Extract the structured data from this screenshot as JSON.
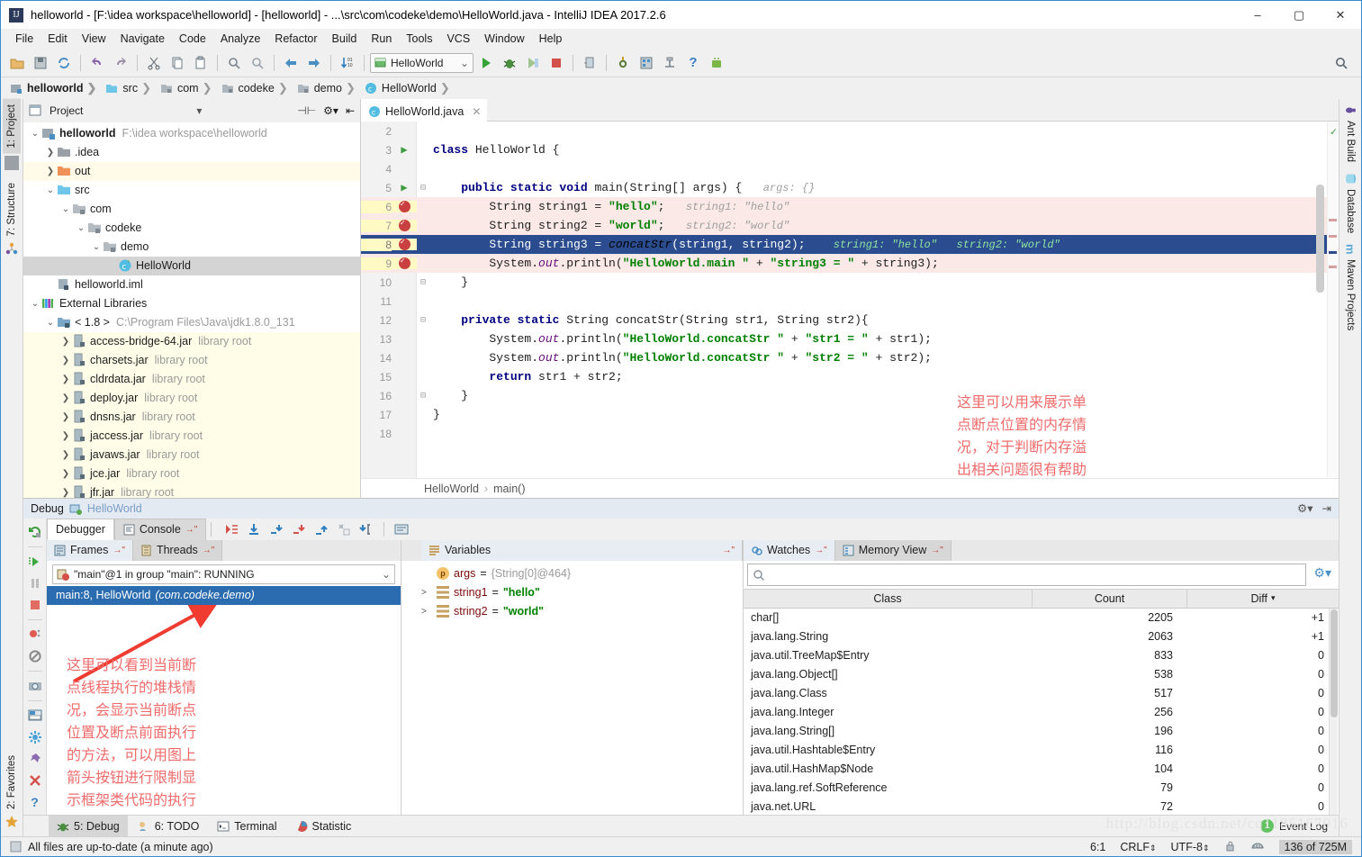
{
  "window": {
    "title": "helloworld - [F:\\idea workspace\\helloworld] - [helloworld] - ...\\src\\com\\codeke\\demo\\HelloWorld.java - IntelliJ IDEA 2017.2.6",
    "minimize": "–",
    "maximize": "▢",
    "close": "✕"
  },
  "menu": [
    "File",
    "Edit",
    "View",
    "Navigate",
    "Code",
    "Analyze",
    "Refactor",
    "Build",
    "Run",
    "Tools",
    "VCS",
    "Window",
    "Help"
  ],
  "toolbar": {
    "run_config": "HelloWorld",
    "icons": [
      "open-icon",
      "save-icon",
      "sync-icon",
      "undo-icon",
      "redo-icon",
      "cut-icon",
      "copy-icon",
      "paste-icon",
      "find-icon",
      "replace-icon",
      "back-icon",
      "forward-icon",
      "sort-icon"
    ],
    "right_icon": "search-everywhere-icon"
  },
  "breadcrumbs": [
    {
      "label": "helloworld",
      "icon": "module-icon"
    },
    {
      "label": "src",
      "icon": "source-folder-icon"
    },
    {
      "label": "com",
      "icon": "package-icon"
    },
    {
      "label": "codeke",
      "icon": "package-icon"
    },
    {
      "label": "demo",
      "icon": "package-icon"
    },
    {
      "label": "HelloWorld",
      "icon": "class-icon"
    }
  ],
  "left_rail": [
    {
      "label": "1: Project",
      "selected": true
    },
    {
      "label": "7: Structure",
      "selected": false
    },
    {
      "label": "2: Favorites",
      "selected": false
    }
  ],
  "right_rail": [
    {
      "label": "Ant Build"
    },
    {
      "label": "Database"
    },
    {
      "label": "Maven Projects"
    }
  ],
  "project_panel": {
    "title": "Project",
    "tree": [
      {
        "indent": 0,
        "arrow": "v",
        "icon": "module-icon",
        "name": "helloworld",
        "sub": "F:\\idea workspace\\helloworld",
        "bold": true,
        "style": ""
      },
      {
        "indent": 1,
        "arrow": ">",
        "icon": "folder-gray-icon",
        "name": ".idea",
        "sub": "",
        "bold": false,
        "style": ""
      },
      {
        "indent": 1,
        "arrow": ">",
        "icon": "folder-orange-icon",
        "name": "out",
        "sub": "",
        "bold": false,
        "style": "out"
      },
      {
        "indent": 1,
        "arrow": "v",
        "icon": "folder-blue-icon",
        "name": "src",
        "sub": "",
        "bold": false,
        "style": ""
      },
      {
        "indent": 2,
        "arrow": "v",
        "icon": "package-icon",
        "name": "com",
        "sub": "",
        "bold": false,
        "style": ""
      },
      {
        "indent": 3,
        "arrow": "v",
        "icon": "package-icon",
        "name": "codeke",
        "sub": "",
        "bold": false,
        "style": ""
      },
      {
        "indent": 4,
        "arrow": "v",
        "icon": "package-icon",
        "name": "demo",
        "sub": "",
        "bold": false,
        "style": ""
      },
      {
        "indent": 5,
        "arrow": "",
        "icon": "class-icon",
        "name": "HelloWorld",
        "sub": "",
        "bold": false,
        "style": "sel"
      },
      {
        "indent": 1,
        "arrow": "",
        "icon": "iml-icon",
        "name": "helloworld.iml",
        "sub": "",
        "bold": false,
        "style": ""
      },
      {
        "indent": 0,
        "arrow": "v",
        "icon": "libraries-icon",
        "name": "External Libraries",
        "sub": "",
        "bold": false,
        "style": ""
      },
      {
        "indent": 1,
        "arrow": "v",
        "icon": "sdk-icon",
        "name": "< 1.8 >",
        "sub": "C:\\Program Files\\Java\\jdk1.8.0_131",
        "bold": false,
        "style": ""
      },
      {
        "indent": 2,
        "arrow": ">",
        "icon": "jar-icon",
        "name": "access-bridge-64.jar",
        "sub": "library root",
        "bold": false,
        "style": "hl"
      },
      {
        "indent": 2,
        "arrow": ">",
        "icon": "jar-icon",
        "name": "charsets.jar",
        "sub": "library root",
        "bold": false,
        "style": "hl"
      },
      {
        "indent": 2,
        "arrow": ">",
        "icon": "jar-icon",
        "name": "cldrdata.jar",
        "sub": "library root",
        "bold": false,
        "style": "hl"
      },
      {
        "indent": 2,
        "arrow": ">",
        "icon": "jar-icon",
        "name": "deploy.jar",
        "sub": "library root",
        "bold": false,
        "style": "hl"
      },
      {
        "indent": 2,
        "arrow": ">",
        "icon": "jar-icon",
        "name": "dnsns.jar",
        "sub": "library root",
        "bold": false,
        "style": "hl"
      },
      {
        "indent": 2,
        "arrow": ">",
        "icon": "jar-icon",
        "name": "jaccess.jar",
        "sub": "library root",
        "bold": false,
        "style": "hl"
      },
      {
        "indent": 2,
        "arrow": ">",
        "icon": "jar-icon",
        "name": "javaws.jar",
        "sub": "library root",
        "bold": false,
        "style": "hl"
      },
      {
        "indent": 2,
        "arrow": ">",
        "icon": "jar-icon",
        "name": "jce.jar",
        "sub": "library root",
        "bold": false,
        "style": "hl"
      },
      {
        "indent": 2,
        "arrow": ">",
        "icon": "jar-icon",
        "name": "jfr.jar",
        "sub": "library root",
        "bold": false,
        "style": "hl"
      }
    ]
  },
  "editor": {
    "tab": {
      "label": "HelloWorld.java",
      "close": "✕"
    },
    "breadcrumb": [
      "HelloWorld",
      "main()"
    ],
    "breadcrumb_sep": "›",
    "lines": [
      {
        "no": "2",
        "mark": "",
        "fold": "",
        "state": "",
        "html": ""
      },
      {
        "no": "3",
        "mark": "run",
        "fold": "",
        "state": "",
        "html": "<span class='kw'>class</span> HelloWorld {"
      },
      {
        "no": "4",
        "mark": "",
        "fold": "",
        "state": "",
        "html": ""
      },
      {
        "no": "5",
        "mark": "run",
        "fold": "-",
        "state": "",
        "html": "    <span class='kw'>public static void</span> main(String[] args) {   <span class='hint'>args: {}</span>"
      },
      {
        "no": "6",
        "mark": "bp",
        "fold": "",
        "state": "bp",
        "html": "        String string1 = <span class='str'>\"hello\"</span>;   <span class='hint'>string1: \"hello\"</span>"
      },
      {
        "no": "7",
        "mark": "bp",
        "fold": "",
        "state": "bp",
        "html": "        String string2 = <span class='str'>\"world\"</span>;   <span class='hint'>string2: \"world\"</span>"
      },
      {
        "no": "8",
        "mark": "bp",
        "fold": "",
        "state": "cur",
        "html": "        String string3 = <span class='mth'>concatStr</span>(string1, string2);    <span class='hint'>string1: \"hello\"   string2: \"world\"</span>"
      },
      {
        "no": "9",
        "mark": "bp",
        "fold": "",
        "state": "bp",
        "html": "        System.<span class='fld'>out</span>.println(<span class='str'>\"HelloWorld.main \"</span> + <span class='str'>\"string3 = \"</span> + string3);"
      },
      {
        "no": "10",
        "mark": "",
        "fold": "-",
        "state": "",
        "html": "    }"
      },
      {
        "no": "11",
        "mark": "",
        "fold": "",
        "state": "",
        "html": ""
      },
      {
        "no": "12",
        "mark": "",
        "fold": "-",
        "state": "",
        "html": "    <span class='kw'>private static</span> String concatStr(String str1, String str2){"
      },
      {
        "no": "13",
        "mark": "",
        "fold": "",
        "state": "",
        "html": "        System.<span class='fld'>out</span>.println(<span class='str'>\"HelloWorld.concatStr \"</span> + <span class='str'>\"str1 = \"</span> + str1);"
      },
      {
        "no": "14",
        "mark": "",
        "fold": "",
        "state": "",
        "html": "        System.<span class='fld'>out</span>.println(<span class='str'>\"HelloWorld.concatStr \"</span> + <span class='str'>\"str2 = \"</span> + str2);"
      },
      {
        "no": "15",
        "mark": "",
        "fold": "",
        "state": "",
        "html": "        <span class='kw'>return</span> str1 + str2;"
      },
      {
        "no": "16",
        "mark": "",
        "fold": "-",
        "state": "",
        "html": "    }"
      },
      {
        "no": "17",
        "mark": "",
        "fold": "",
        "state": "",
        "html": "}"
      },
      {
        "no": "18",
        "mark": "",
        "fold": "",
        "state": "",
        "html": ""
      }
    ]
  },
  "annotations": {
    "memory_note": "这里可以用来展示单\n点断点位置的内存情\n况，对于判断内存溢\n出相关问题很有帮助",
    "frames_note": "这里可以看到当前断\n点线程执行的堆栈情\n况，会显示当前断点\n位置及断点前面执行\n的方法，可以用图上\n箭头按钮进行限制显\n示框架类代码的执行\n过程",
    "color": "#ef6b6b"
  },
  "debug": {
    "header": {
      "label": "Debug",
      "config": "HelloWorld",
      "settings_icon": "gear-icon",
      "hide_icon": "hide-icon"
    },
    "tabs": [
      {
        "label": "Debugger",
        "selected": true,
        "icon": ""
      },
      {
        "label": "Console",
        "selected": false,
        "icon": "console-icon",
        "pin": "→\""
      }
    ],
    "step_buttons": [
      "show-execution-point-icon",
      "step-over-icon",
      "step-into-icon",
      "force-step-into-icon",
      "step-out-icon",
      "drop-frame-icon",
      "run-to-cursor-icon",
      "evaluate-expression-icon"
    ],
    "rail_buttons": [
      "rerun-icon",
      "resume-icon",
      "pause-icon",
      "stop-icon",
      "view-breakpoints-icon",
      "mute-breakpoints-icon",
      "screenshot-icon",
      "layout-icon",
      "settings-icon",
      "pin-icon",
      "close-icon",
      "help-icon"
    ],
    "frames_pane": {
      "tabs": [
        {
          "label": "Frames",
          "selected": true,
          "icon": "frames-icon"
        },
        {
          "label": "Threads",
          "selected": false,
          "icon": "threads-icon"
        }
      ],
      "thread_selector": "\"main\"@1 in group \"main\": RUNNING",
      "frames": [
        {
          "label": "main:8, HelloWorld",
          "pkg": "(com.codeke.demo)",
          "selected": true
        }
      ],
      "nav_icons": [
        "arrow-up-icon",
        "arrow-down-icon",
        "filter-icon"
      ]
    },
    "variables_pane": {
      "title": "Variables",
      "pin": "→\"",
      "rows": [
        {
          "arrow": "",
          "icon": "parameter-icon",
          "name": "args",
          "eq": "=",
          "value": "{String[0]@464}",
          "gray": true
        },
        {
          "arrow": ">",
          "icon": "field-icon",
          "name": "string1",
          "eq": "=",
          "value": "\"hello\"",
          "gray": false
        },
        {
          "arrow": ">",
          "icon": "field-icon",
          "name": "string2",
          "eq": "=",
          "value": "\"world\"",
          "gray": false
        }
      ]
    },
    "memory_pane": {
      "tabs": [
        {
          "label": "Watches",
          "selected": true,
          "icon": "watches-icon",
          "pin": "→\""
        },
        {
          "label": "Memory View",
          "selected": false,
          "icon": "memory-icon",
          "pin": "→\""
        }
      ],
      "search_placeholder": "",
      "search_value": "",
      "settings_icon": "gear-icon",
      "columns": [
        "Class",
        "Count",
        "Diff"
      ],
      "sort_column": "Diff",
      "sort_arrow": "▾",
      "rows": [
        {
          "class": "char[]",
          "count": "2205",
          "diff": "+1"
        },
        {
          "class": "java.lang.String",
          "count": "2063",
          "diff": "+1"
        },
        {
          "class": "java.util.TreeMap$Entry",
          "count": "833",
          "diff": "0"
        },
        {
          "class": "java.lang.Object[]",
          "count": "538",
          "diff": "0"
        },
        {
          "class": "java.lang.Class",
          "count": "517",
          "diff": "0"
        },
        {
          "class": "java.lang.Integer",
          "count": "256",
          "diff": "0"
        },
        {
          "class": "java.lang.String[]",
          "count": "196",
          "diff": "0"
        },
        {
          "class": "java.util.Hashtable$Entry",
          "count": "116",
          "diff": "0"
        },
        {
          "class": "java.util.HashMap$Node",
          "count": "104",
          "diff": "0"
        },
        {
          "class": "java.lang.ref.SoftReference",
          "count": "79",
          "diff": "0"
        },
        {
          "class": "java.net.URL",
          "count": "72",
          "diff": "0"
        }
      ]
    }
  },
  "toolwindow_bar": {
    "items": [
      {
        "label": "5: Debug",
        "underline": "5",
        "icon": "debug-icon",
        "selected": true
      },
      {
        "label": "6: TODO",
        "underline": "6",
        "icon": "todo-icon",
        "selected": false
      },
      {
        "label": "Terminal",
        "underline": "",
        "icon": "terminal-icon",
        "selected": false
      },
      {
        "label": "Statistic",
        "underline": "",
        "icon": "statistic-icon",
        "selected": false
      }
    ],
    "event_log": {
      "label": "Event Log",
      "count": "1"
    }
  },
  "status_bar": {
    "message": "All files are up-to-date (a minute ago)",
    "caret": "6:1",
    "line_separator": "CRLF",
    "encoding": "UTF-8",
    "lock_icon": "lock-icon",
    "hector_icon": "hector-icon",
    "memory": "136 of 725M"
  },
  "watermark": "http://blog.csdn.net/cq1185167016"
}
